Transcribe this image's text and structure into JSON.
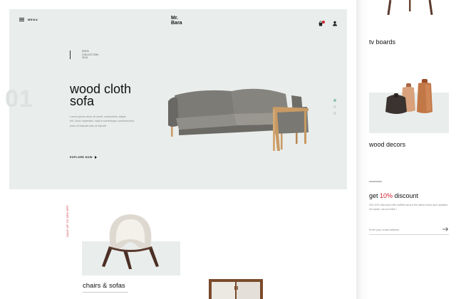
{
  "header": {
    "menu_label": "MENU",
    "logo_line1": "Mr.",
    "logo_line2": "Bara"
  },
  "hero": {
    "collection_line1": "SOFA",
    "collection_line2": "COLLECTION",
    "collection_line3": "2015",
    "slide_number": "01",
    "title_line1": "wood cloth",
    "title_line2": "sofa",
    "description_line1": "Lorem ipsum dolor sit amet, consectetur adipis",
    "description_line2": "elit. Nunc imperdiet, nulla a scelerisque condimentum,",
    "description_line3": "enim mi blandit erat, at blandit",
    "explore_label": "EXPLORE NOW",
    "slide_count": 3,
    "active_slide": 1
  },
  "products": {
    "chairs_badge": "SALE UP TO 30% OFF",
    "chairs_label": "chairs & sofas"
  },
  "sidebar": {
    "tv_label": "tv boards",
    "decor_label": "wood decors",
    "discount_prefix": "get ",
    "discount_value": "10%",
    "discount_suffix": " discount",
    "discount_desc": "Get 10% discount with notified about the latest news and updates. No spam, we promise !",
    "email_placeholder": "Enter your email address"
  },
  "colors": {
    "accent_red": "#d0242d",
    "panel_bg": "#e9edec",
    "active_dot": "#8fc2b5"
  }
}
